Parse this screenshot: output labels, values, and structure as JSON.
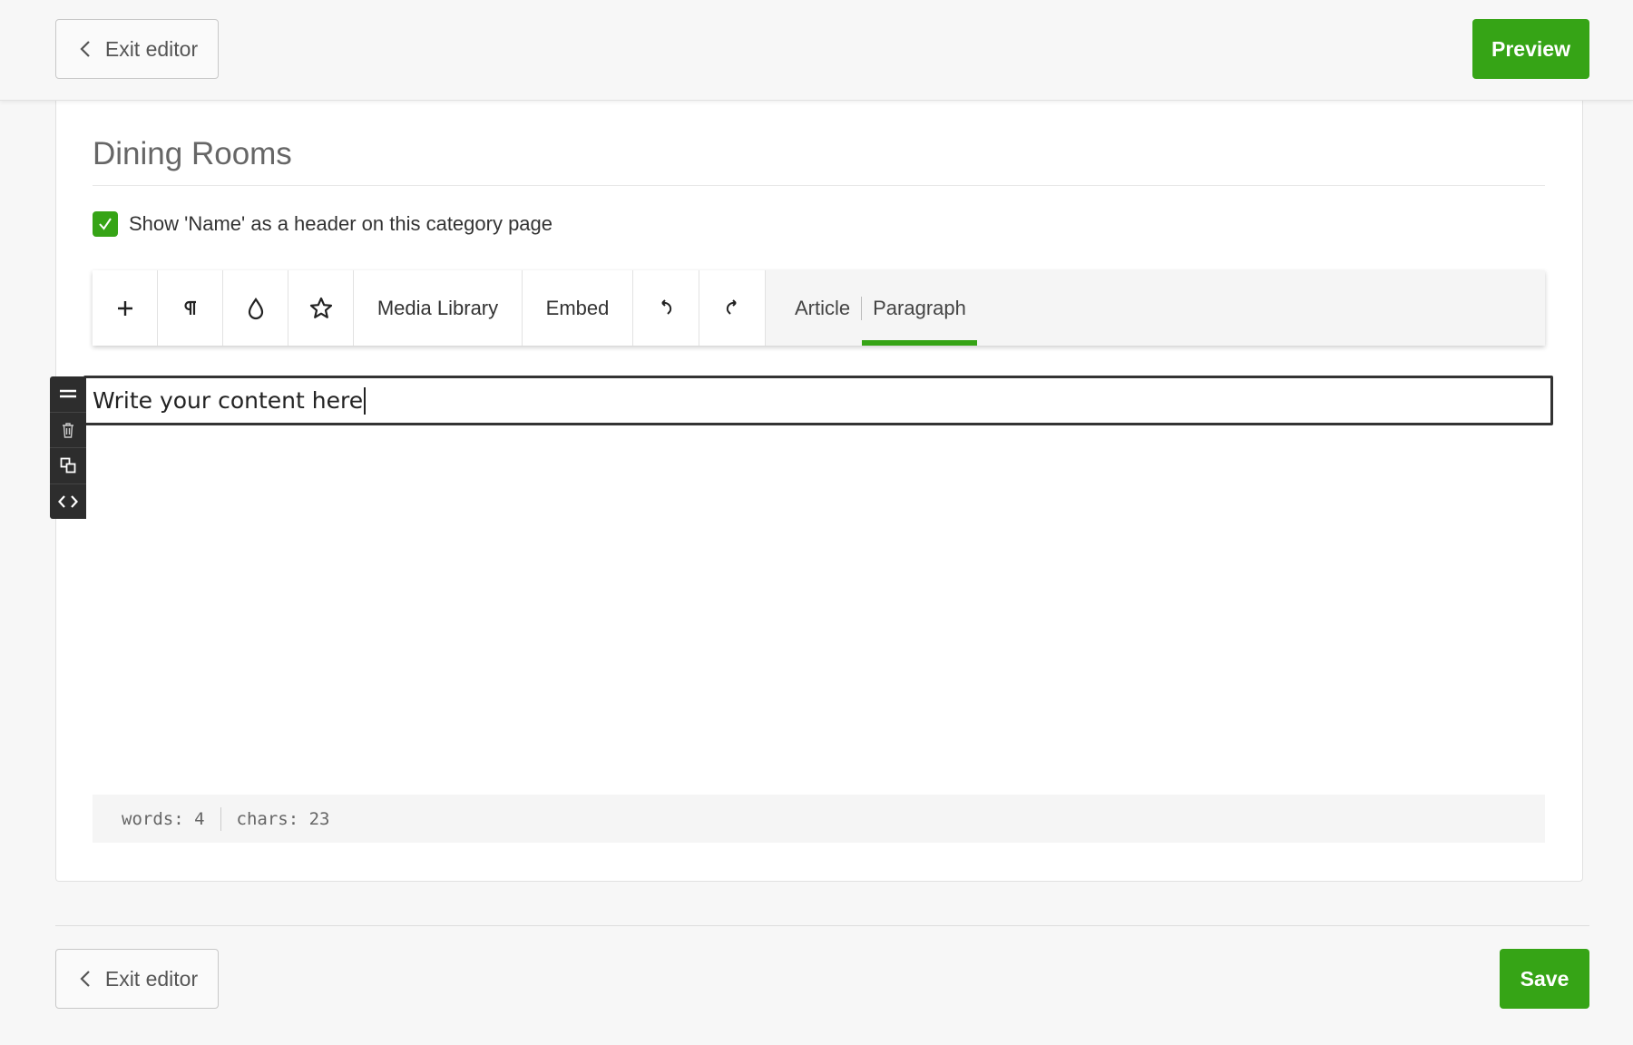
{
  "header": {
    "exit_label": "Exit editor",
    "preview_label": "Preview"
  },
  "category": {
    "title": "Dining Rooms",
    "show_name_label": "Show 'Name' as a header on this category page",
    "show_name_checked": true
  },
  "toolbar": {
    "icons": [
      "plus-icon",
      "pilcrow-icon",
      "droplet-icon",
      "star-icon"
    ],
    "media_library_label": "Media Library",
    "embed_label": "Embed",
    "undo_icon": "undo-icon",
    "redo_icon": "redo-icon",
    "tabs": [
      {
        "label": "Article",
        "active": false
      },
      {
        "label": "Paragraph",
        "active": true
      }
    ]
  },
  "editor": {
    "content": "Write your content here",
    "block_tools": [
      "drag-handle-icon",
      "trash-icon",
      "duplicate-icon",
      "code-icon"
    ]
  },
  "stats": {
    "words": "words: 4",
    "chars": "chars: 23"
  },
  "footer": {
    "exit_label": "Exit editor",
    "save_label": "Save"
  },
  "colors": {
    "accent": "#36a416",
    "block_tools_bg": "#2d2d2d"
  }
}
